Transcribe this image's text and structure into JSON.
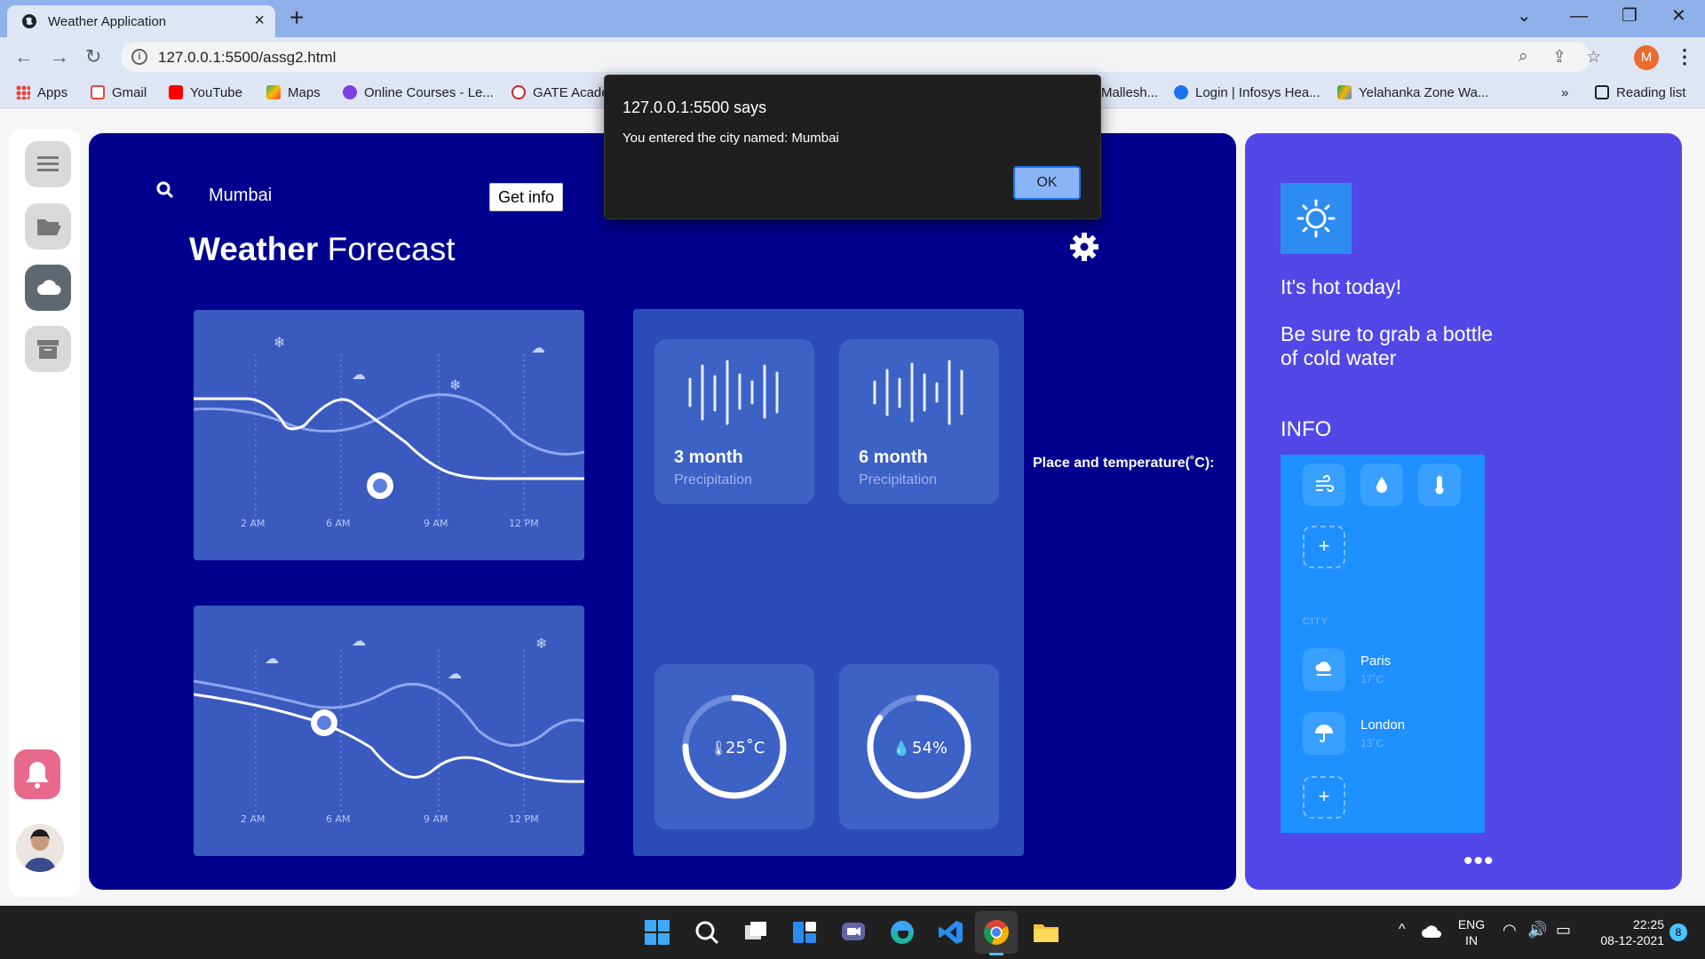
{
  "browser": {
    "tab_title": "Weather Application",
    "url": "127.0.0.1:5500/assg2.html",
    "profile_initial": "M",
    "bookmarks": [
      {
        "label": "Apps",
        "icon": "apps-grid-icon"
      },
      {
        "label": "Gmail",
        "icon": "gmail-icon"
      },
      {
        "label": "YouTube",
        "icon": "youtube-icon"
      },
      {
        "label": "Maps",
        "icon": "maps-icon"
      },
      {
        "label": "Online Courses - Le...",
        "icon": "courses-icon"
      },
      {
        "label": "GATE Acade",
        "icon": "gate-icon"
      },
      {
        "label": "Mallesh...",
        "icon": ""
      },
      {
        "label": "Login | Infosys Hea...",
        "icon": "infosys-icon"
      },
      {
        "label": "Yelahanka Zone Wa...",
        "icon": "drive-icon"
      }
    ],
    "more_bookmarks": "»",
    "reading_list": "Reading list"
  },
  "app": {
    "search_value": "Mumbai",
    "get_info_label": "Get info",
    "title_bold": "Weather",
    "title_rest": "Forecast",
    "chart_times": [
      "2 AM",
      "6 AM",
      "9 AM",
      "12 PM"
    ],
    "precip_cards": [
      {
        "title": "3 month",
        "subtitle": "Precipitation"
      },
      {
        "title": "6 month",
        "subtitle": "Precipitation"
      }
    ],
    "gauges": [
      {
        "value": "25˚C",
        "fraction": 0.75
      },
      {
        "value": "54%",
        "fraction": 0.85
      }
    ],
    "place_label": "Place and temperature(˚C):"
  },
  "side_panel": {
    "hot_text": "It's hot today!",
    "tip_text": "Be sure to grab a bottle of cold water",
    "info_title": "INFO",
    "city_label": "CITY",
    "cities": [
      {
        "name": "Paris",
        "temp": "17˚C"
      },
      {
        "name": "London",
        "temp": "13˚C"
      }
    ],
    "add_symbol": "+",
    "more_dots": "•••"
  },
  "dialog": {
    "title": "127.0.0.1:5500 says",
    "message": "You entered the city named: Mumbai",
    "ok_label": "OK"
  },
  "taskbar": {
    "language": "ENG",
    "region": "IN",
    "time": "22:25",
    "date": "08-12-2021",
    "notifications": "8"
  },
  "colors": {
    "main_bg": "#00008f",
    "side_bg": "#5248e8",
    "info_card": "#1e90ff",
    "bell": "#e8698c"
  }
}
